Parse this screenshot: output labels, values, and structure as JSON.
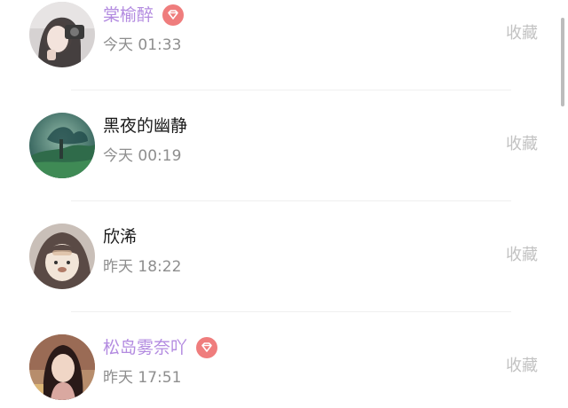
{
  "items": [
    {
      "name": "棠榆醉",
      "vip": true,
      "time": "今天 01:33",
      "action": "收藏"
    },
    {
      "name": "黑夜的幽静",
      "vip": false,
      "time": "今天 00:19",
      "action": "收藏"
    },
    {
      "name": "欣浠",
      "vip": false,
      "time": "昨天 18:22",
      "action": "收藏"
    },
    {
      "name": "松岛雾奈吖",
      "vip": true,
      "time": "昨天 17:51",
      "action": "收藏"
    }
  ],
  "colors": {
    "vip_name": "#b38be0",
    "vip_badge": "#ef7d7d",
    "time_text": "#8e8e8e",
    "action_text": "#c2c2c2"
  }
}
